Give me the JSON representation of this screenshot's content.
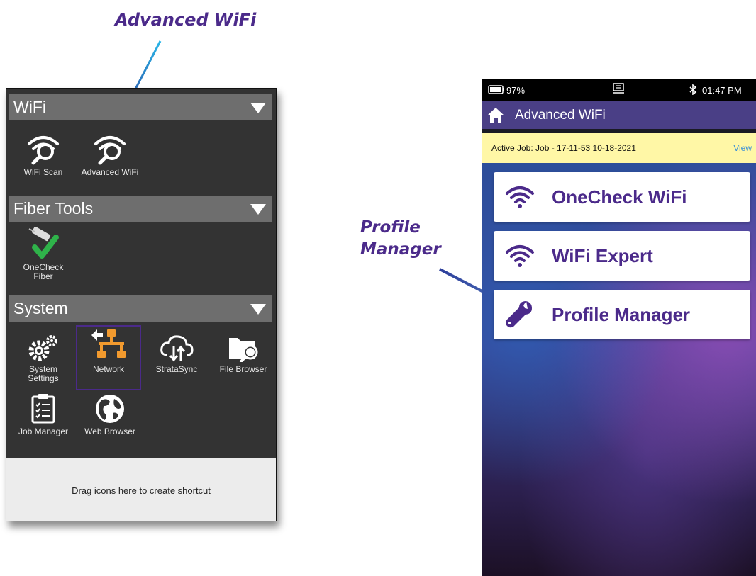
{
  "callouts": {
    "advanced_wifi": "Advanced WiFi",
    "profile_manager_line1": "Profile",
    "profile_manager_line2": "Manager"
  },
  "left_panel": {
    "sections": [
      {
        "title": "WiFi",
        "tiles": [
          {
            "label": "WiFi Scan",
            "icon": "wifi-search-icon"
          },
          {
            "label": "Advanced WiFi",
            "icon": "wifi-search-icon"
          }
        ]
      },
      {
        "title": "Fiber Tools",
        "tiles": [
          {
            "label_line1": "OneCheck",
            "label_line2": "Fiber",
            "icon": "fiber-connector-check-icon"
          }
        ]
      },
      {
        "title": "System",
        "tiles": [
          {
            "label_line1": "System",
            "label_line2": "Settings",
            "icon": "gears-icon"
          },
          {
            "label": "Network",
            "icon": "network-icon"
          },
          {
            "label": "StrataSync",
            "icon": "cloud-sync-icon"
          },
          {
            "label": "File Browser",
            "icon": "folder-search-icon"
          },
          {
            "label": "Job Manager",
            "icon": "clipboard-checklist-icon"
          },
          {
            "label": "Web Browser",
            "icon": "globe-icon"
          }
        ]
      }
    ],
    "drop_zone": "Drag icons here to create shortcut"
  },
  "phone": {
    "status": {
      "battery": "97%",
      "time": "01:47 PM"
    },
    "app_title": "Advanced WiFi",
    "job_bar": {
      "text": "Active Job: Job - 17-11-53 10-18-2021",
      "view": "View"
    },
    "menu": [
      {
        "label": "OneCheck WiFi",
        "icon": "wifi-icon"
      },
      {
        "label": "WiFi Expert",
        "icon": "wifi-icon"
      },
      {
        "label": "Profile Manager",
        "icon": "wrench-icon"
      }
    ]
  },
  "colors": {
    "accent": "#4b2a8a",
    "arrow": "#1f6fbf",
    "job_bar": "#fff7a6",
    "app_bar": "#4a3f86"
  }
}
